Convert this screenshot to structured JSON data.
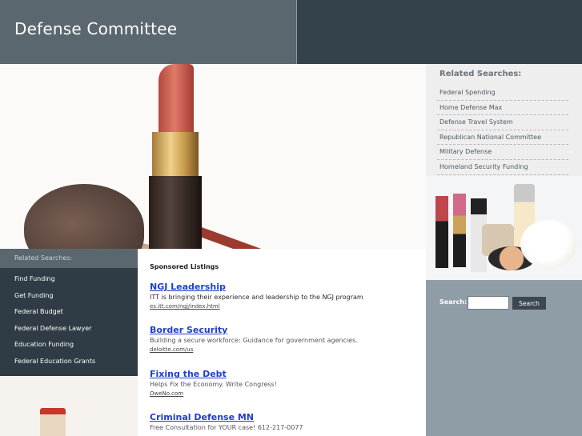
{
  "site": {
    "title": "Defense Committee"
  },
  "related_right": {
    "title": "Related Searches:",
    "items": [
      "Federal Spending",
      "Home Defense Max",
      "Defense Travel System",
      "Republican National Committee",
      "Military Defense",
      "Homeland Security Funding"
    ]
  },
  "search": {
    "label": "Search:",
    "button": "Search",
    "value": ""
  },
  "left_nav": {
    "title": "Related Searches:",
    "items": [
      "Find Funding",
      "Get Funding",
      "Federal Budget",
      "Federal Defense Lawyer",
      "Education Funding",
      "Federal Education Grants"
    ]
  },
  "listings": {
    "title": "Sponsored Listings",
    "items": [
      {
        "title": "NGJ Leadership",
        "desc": "ITT is bringing their experience and leadership to the NGJ program",
        "url": "es.itt.com/ngj/index.html"
      },
      {
        "title": "Border Security",
        "desc": "Building a secure workforce: Guidance for government agencies.",
        "url": "deloitte.com/us"
      },
      {
        "title": "Fixing the Debt",
        "desc": "Helps Fix the Economy. Write Congress!",
        "url": "OweNo.com"
      },
      {
        "title": "Criminal Defense MN",
        "desc": "Free Consultation for YOUR case! 612-217-0077",
        "url": ""
      }
    ]
  }
}
